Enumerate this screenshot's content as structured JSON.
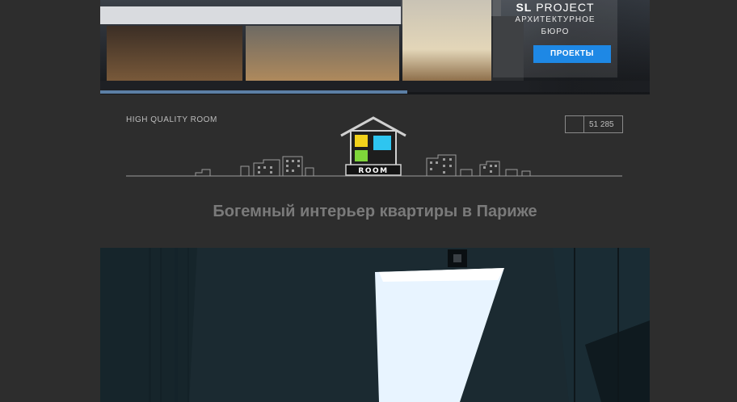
{
  "banner": {
    "company_name": "SL PROJECT",
    "company_name_bold": "SL",
    "company_name_rest": " PROJECT",
    "company_subtitle": "АРХИТЕКТУРНОЕ\nБЮРО",
    "projects_button": "ПРОЕКТЫ"
  },
  "header": {
    "site_label": "HIGH QUALITY ROOM",
    "logo_text": "ROOM",
    "counter_value": "51 285"
  },
  "article": {
    "title": "Богемный интерьер квартиры в Париже"
  },
  "colors": {
    "background": "#2d2d2d",
    "accent_blue": "#1e88e5",
    "logo_yellow": "#f2d21b",
    "logo_cyan": "#2ec5f0",
    "logo_green": "#7fd63a"
  }
}
